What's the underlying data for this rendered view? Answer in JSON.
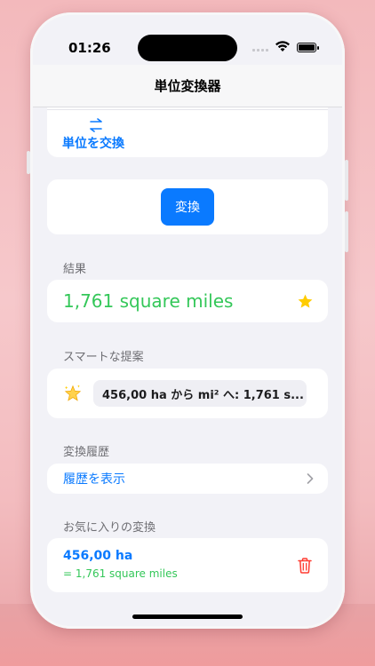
{
  "status": {
    "time": "01:26"
  },
  "nav": {
    "title": "単位変換器"
  },
  "swap": {
    "label": "単位を交換"
  },
  "convert": {
    "label": "変換"
  },
  "result": {
    "header": "結果",
    "value": "1,761 square miles"
  },
  "suggestions": {
    "header": "スマートな提案",
    "item": "456,00 ha から mi² へ: 1,761 s..."
  },
  "history": {
    "header": "変換履歴",
    "link": "履歴を表示"
  },
  "favorites": {
    "header": "お気に入りの変換",
    "item": {
      "main": "456,00 ha",
      "sub": "= 1,761 square miles"
    }
  },
  "colors": {
    "accent": "#0a7aff",
    "result_green": "#34c759",
    "star": "#ffcc00",
    "delete": "#ff3b30"
  }
}
